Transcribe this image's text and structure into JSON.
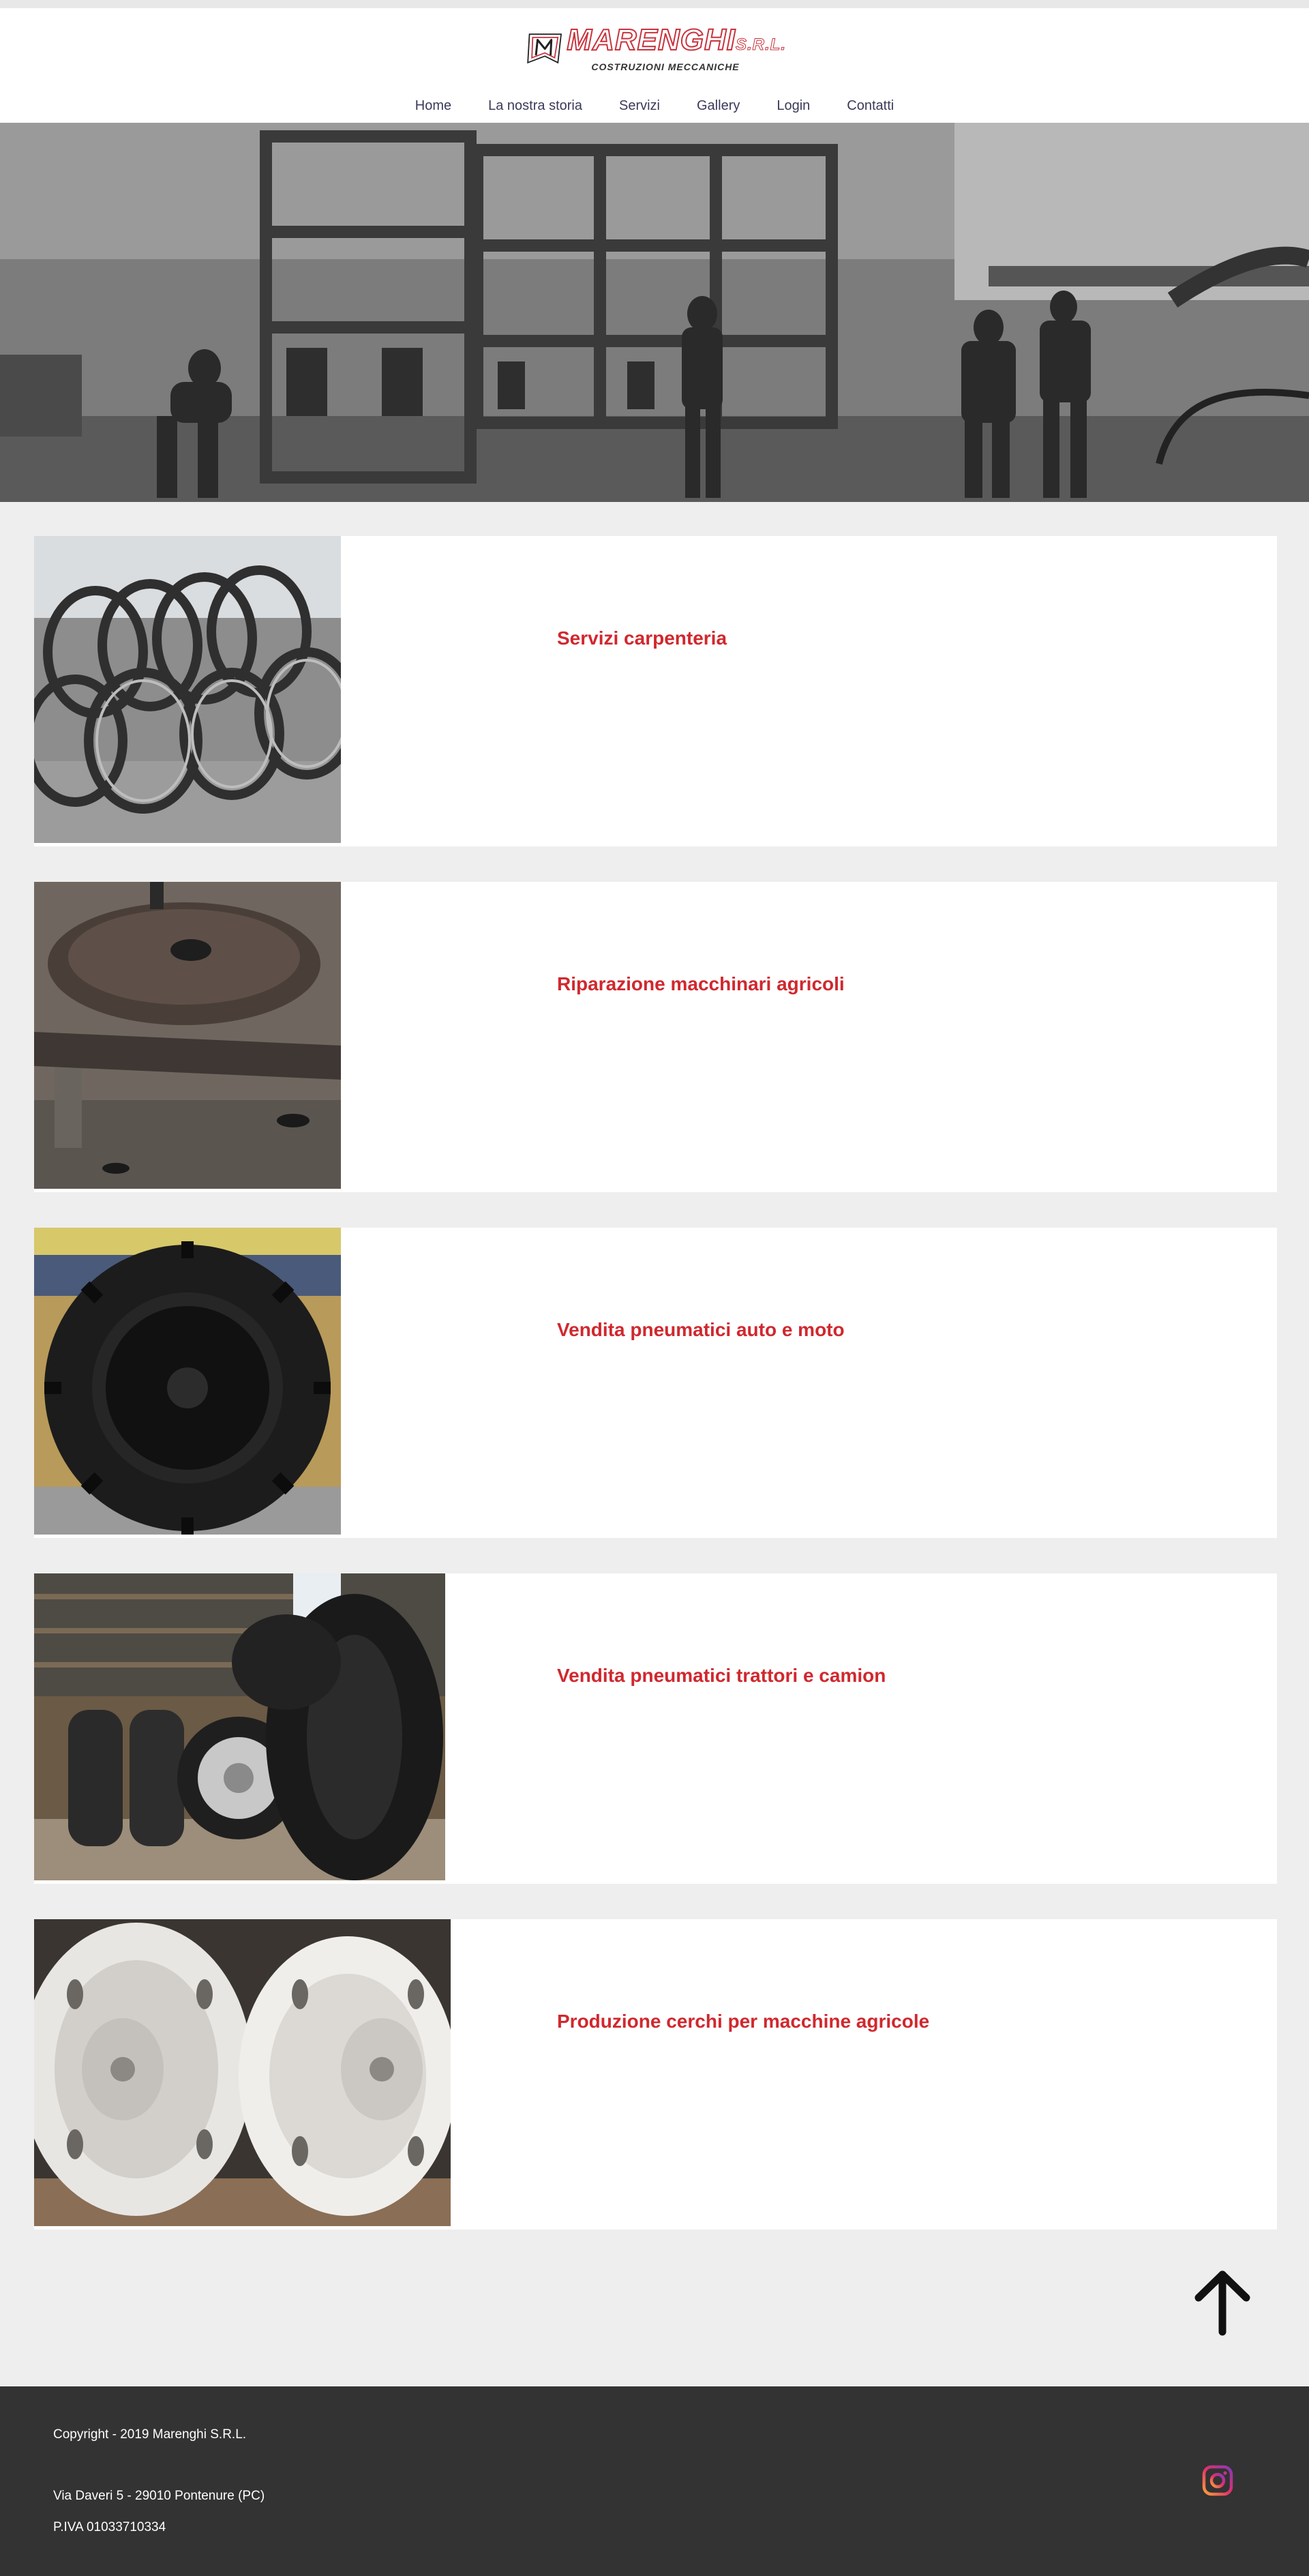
{
  "brand": {
    "name": "MARENGHI",
    "suffix": "S.R.L.",
    "subtitle": "COSTRUZIONI MECCANICHE"
  },
  "nav": {
    "items": [
      {
        "label": "Home"
      },
      {
        "label": "La nostra storia"
      },
      {
        "label": "Servizi"
      },
      {
        "label": "Gallery"
      },
      {
        "label": "Login"
      },
      {
        "label": "Contatti"
      }
    ]
  },
  "services": [
    {
      "title": "Servizi carpenteria",
      "image": "steel-rims-stack-photo"
    },
    {
      "title": "Riparazione macchinari agricoli",
      "image": "wheel-disc-repair-photo"
    },
    {
      "title": "Vendita pneumatici auto e moto",
      "image": "tractor-tire-photo"
    },
    {
      "title": "Vendita pneumatici trattori e camion",
      "image": "truck-tractor-tires-photo"
    },
    {
      "title": "Produzione cerchi per macchine agricole",
      "image": "white-rims-photo"
    }
  ],
  "footer": {
    "copyright": "Copyright - 2019 Marenghi S.R.L.",
    "address": "Via Daveri 5 - 29010 Pontenure (PC)",
    "vat": "P.IVA 01033710334"
  },
  "icons": {
    "scroll_top": "arrow-up-icon",
    "social": "instagram-icon"
  },
  "colors": {
    "accent": "#d0282e",
    "footer_bg": "#333333",
    "page_bg": "#eeeeee",
    "nav_text": "#3a3a5a"
  }
}
